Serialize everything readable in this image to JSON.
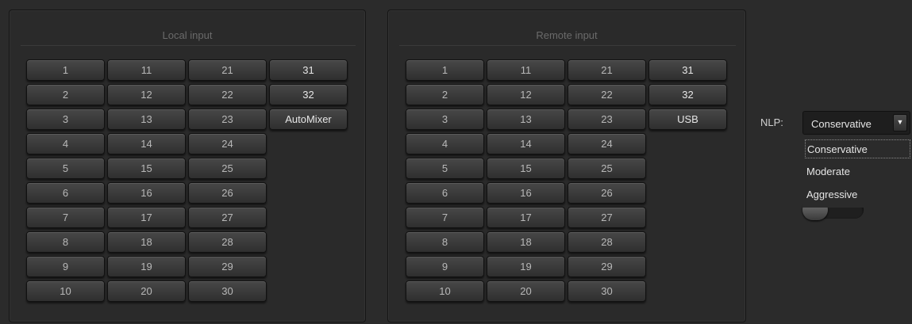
{
  "local_input": {
    "title": "Local input",
    "buttons": [
      "1",
      "11",
      "21",
      "31",
      "2",
      "12",
      "22",
      "32",
      "3",
      "13",
      "23",
      "AutoMixer",
      "4",
      "14",
      "24",
      "",
      "5",
      "15",
      "25",
      "",
      "6",
      "16",
      "26",
      "",
      "7",
      "17",
      "27",
      "",
      "8",
      "18",
      "28",
      "",
      "9",
      "19",
      "29",
      "",
      "10",
      "20",
      "30",
      ""
    ],
    "active_col": 3
  },
  "remote_input": {
    "title": "Remote input",
    "buttons": [
      "1",
      "11",
      "21",
      "31",
      "2",
      "12",
      "22",
      "32",
      "3",
      "13",
      "23",
      "USB",
      "4",
      "14",
      "24",
      "",
      "5",
      "15",
      "25",
      "",
      "6",
      "16",
      "26",
      "",
      "7",
      "17",
      "27",
      "",
      "8",
      "18",
      "28",
      "",
      "9",
      "19",
      "29",
      "",
      "10",
      "20",
      "30",
      ""
    ],
    "active_col": 3
  },
  "nlp": {
    "label": "NLP:",
    "selected": "Conservative",
    "arrow_icon": "dropdown-arrow-icon",
    "options": [
      "Conservative",
      "Moderate",
      "Aggressive"
    ]
  },
  "colors": {
    "background": "#2b2b2b",
    "button_text": "#b8b8b8",
    "title_text": "#6a6a6a"
  }
}
